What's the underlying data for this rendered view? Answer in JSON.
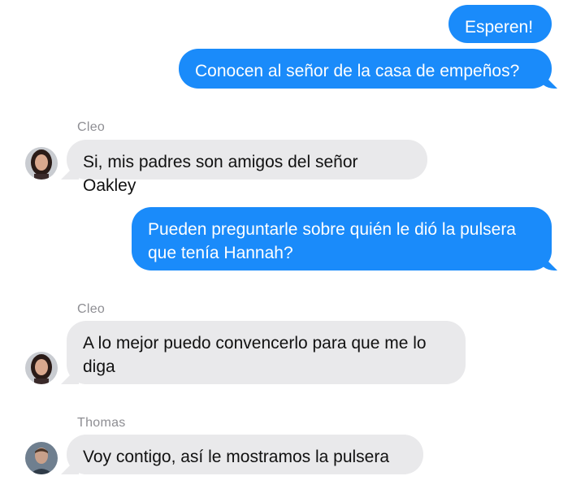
{
  "colors": {
    "sent_bubble": "#1a8bfa",
    "received_bubble": "#e9e9eb",
    "sender_name": "#8e8e93"
  },
  "messages": [
    {
      "type": "sent",
      "text": "Esperen!"
    },
    {
      "type": "sent",
      "text": "Conocen al señor de la casa de empeños?"
    },
    {
      "type": "received",
      "sender": "Cleo",
      "avatar": "cleo-avatar",
      "text": "Si, mis padres son amigos del señor Oakley"
    },
    {
      "type": "sent",
      "text": "Pueden preguntarle sobre quién le dió la pulsera que tenía Hannah?"
    },
    {
      "type": "received",
      "sender": "Cleo",
      "avatar": "cleo-avatar",
      "text": "A lo mejor puedo convencerlo para que me lo diga"
    },
    {
      "type": "received",
      "sender": "Thomas",
      "avatar": "thomas-avatar",
      "text": "Voy contigo, así le mostramos la pulsera"
    }
  ]
}
